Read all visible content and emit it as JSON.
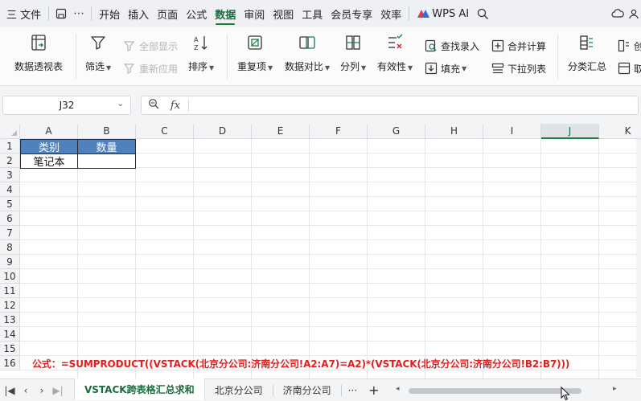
{
  "menubar": {
    "hamburger_label": "三 文件",
    "tabs": [
      "开始",
      "插入",
      "页面",
      "公式",
      "数据",
      "审阅",
      "视图",
      "工具",
      "会员专享",
      "效率"
    ],
    "active_tab": "数据",
    "wps_ai": "WPS AI"
  },
  "ribbon": {
    "pivot": "数据透视表",
    "filter": "筛选",
    "show_all": "全部显示",
    "reapply": "重新应用",
    "sort": "排序",
    "duplicates": "重复项",
    "compare": "数据对比",
    "split": "分列",
    "validity": "有效性",
    "lookup_entry": "查找录入",
    "fill": "填充",
    "consolidate": "合并计算",
    "dropdown_list": "下拉列表",
    "subtotal": "分类汇总",
    "create_partial": "创",
    "fetch_partial": "取"
  },
  "formula_bar": {
    "name_box": "J32",
    "fx": "fx",
    "formula": ""
  },
  "grid": {
    "columns": [
      "A",
      "B",
      "C",
      "D",
      "E",
      "F",
      "G",
      "H",
      "I",
      "J",
      "K"
    ],
    "selected_column": "J",
    "rows": [
      "1",
      "2",
      "3",
      "4",
      "5",
      "6",
      "7",
      "8",
      "9",
      "10",
      "11",
      "12",
      "13",
      "14",
      "15",
      "16"
    ],
    "cells": {
      "A1": "类别",
      "B1": "数量",
      "A2": "笔记本",
      "B2": ""
    },
    "header_fill": "#4f81bd",
    "note": "公式：=SUMPRODUCT((VSTACK(北京分公司:济南分公司!A2:A7)=A2)*(VSTACK(北京分公司:济南分公司!B2:B7)))",
    "note_color": "#e0201f"
  },
  "sheets": {
    "tabs": [
      "VSTACK跨表格汇总求和",
      "北京分公司",
      "济南分公司"
    ],
    "active": "VSTACK跨表格汇总求和",
    "more": "···",
    "add": "+"
  }
}
